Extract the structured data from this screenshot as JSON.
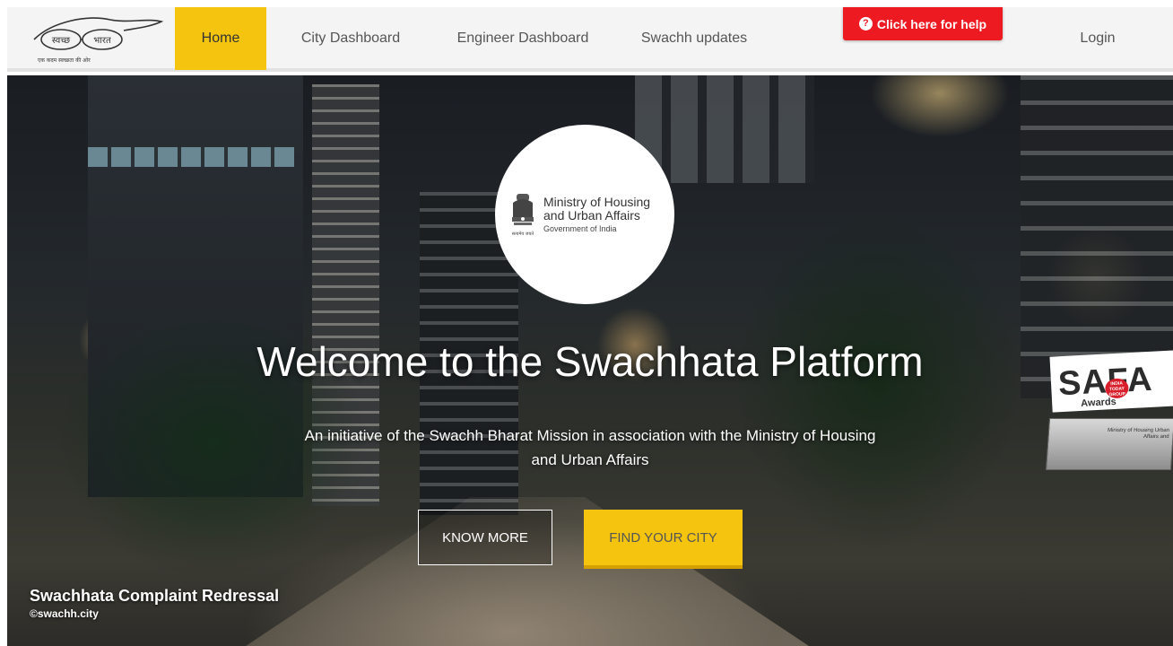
{
  "nav": {
    "logo": {
      "left_text": "स्वच्छ",
      "right_text": "भारत",
      "tagline": "एक कदम स्वच्छता की ओर"
    },
    "items": [
      {
        "label": "Home",
        "active": true
      },
      {
        "label": "City Dashboard"
      },
      {
        "label": "Engineer Dashboard"
      },
      {
        "label": "Swachh updates"
      }
    ],
    "help_label": "Click here for help",
    "login_label": "Login"
  },
  "hero": {
    "ministry": {
      "name": "Ministry of Housing and Urban Affairs",
      "government": "Government of India",
      "emblem_motto": "सत्यमेव जयते"
    },
    "title": "Welcome to the Swachhata Platform",
    "subtitle": "An initiative of the Swachh Bharat Mission in association with the Ministry of Housing and Urban Affairs",
    "buttons": {
      "know_more": "KNOW MORE",
      "find_city": "FIND YOUR CITY"
    },
    "award": {
      "title": "SAFA",
      "subtitle": "Awards",
      "badge": "INDIA TODAY GROUP",
      "plaque_text": "Ministry of Housing Urban Affairs and"
    }
  },
  "watermark": {
    "title": "Swachhata Complaint Redressal",
    "credit": "©swachh.city"
  },
  "colors": {
    "accent_yellow": "#f4c40f",
    "help_red": "#ee1a22",
    "nav_bg": "#f4f4f4"
  }
}
